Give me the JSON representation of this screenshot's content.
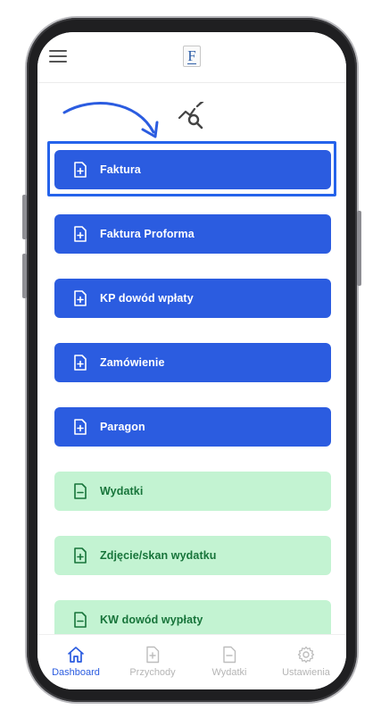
{
  "header": {
    "logo_letter": "F"
  },
  "menu": {
    "items": [
      {
        "label": "Faktura",
        "style": "income",
        "icon": "file-plus-icon"
      },
      {
        "label": "Faktura Proforma",
        "style": "income",
        "icon": "file-plus-icon"
      },
      {
        "label": "KP dowód wpłaty",
        "style": "income",
        "icon": "file-plus-icon"
      },
      {
        "label": "Zamówienie",
        "style": "income",
        "icon": "file-plus-icon"
      },
      {
        "label": "Paragon",
        "style": "income",
        "icon": "file-plus-icon"
      },
      {
        "label": "Wydatki",
        "style": "expense",
        "icon": "file-minus-icon"
      },
      {
        "label": "Zdjęcie/skan wydatku",
        "style": "expense",
        "icon": "file-plus-icon"
      },
      {
        "label": "KW dowód wypłaty",
        "style": "expense",
        "icon": "file-minus-icon"
      }
    ]
  },
  "bottom_nav": {
    "items": [
      {
        "label": "Dashboard",
        "icon": "home-icon",
        "active": true
      },
      {
        "label": "Przychody",
        "icon": "file-plus-icon",
        "active": false
      },
      {
        "label": "Wydatki",
        "icon": "file-minus-icon",
        "active": false
      },
      {
        "label": "Ustawienia",
        "icon": "gear-icon",
        "active": false
      }
    ]
  },
  "colors": {
    "income_button": "#2b5ce0",
    "expense_button": "#c3f3d2",
    "expense_text": "#17743a",
    "highlight": "#2563eb",
    "nav_active": "#2b5ce0",
    "nav_inactive": "#b5b5b5"
  }
}
